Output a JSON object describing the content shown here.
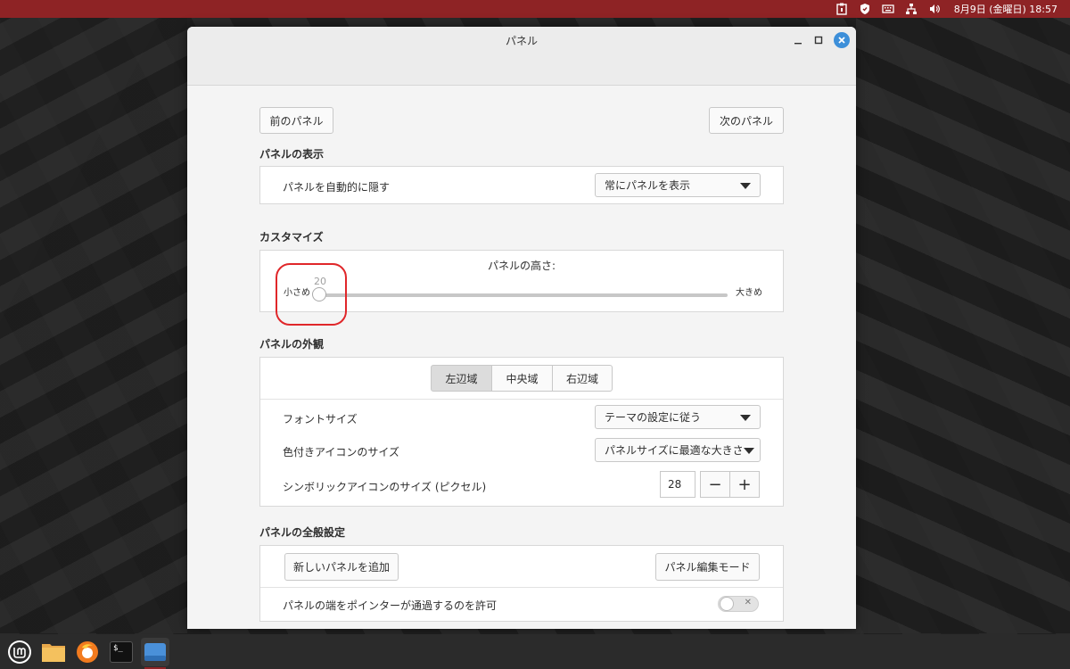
{
  "topbar": {
    "clock": "8月9日 (金曜日) 18:57",
    "color": "#8e2325",
    "icons": [
      "clipboard-icon",
      "shield-icon",
      "keyboard-icon",
      "network-icon",
      "volume-icon"
    ]
  },
  "window": {
    "title": "パネル",
    "controls": {
      "minimize": "_",
      "maximize": "□",
      "close": "×"
    }
  },
  "nav": {
    "prev_panel": "前のパネル",
    "next_panel": "次のパネル"
  },
  "display_section": {
    "title": "パネルの表示",
    "autohide_label": "パネルを自動的に隠す",
    "autohide_value": "常にパネルを表示"
  },
  "customize_section": {
    "title": "カスタマイズ",
    "height_label": "パネルの高さ:",
    "min_label": "小さめ",
    "max_label": "大きめ",
    "height_value": "20"
  },
  "appearance_section": {
    "title": "パネルの外観",
    "zones": [
      "左辺域",
      "中央域",
      "右辺域"
    ],
    "active_zone": "左辺域",
    "font_size_label": "フォントサイズ",
    "font_size_value": "テーマの設定に従う",
    "color_icon_label": "色付きアイコンのサイズ",
    "color_icon_value": "パネルサイズに最適な大きさ",
    "symbolic_icon_label": "シンボリックアイコンのサイズ (ピクセル)",
    "symbolic_icon_value": "28",
    "minus": "−",
    "plus": "+"
  },
  "general_section": {
    "title": "パネルの全般設定",
    "add_panel": "新しいパネルを追加",
    "edit_mode": "パネル編集モード",
    "pointer_pass_label": "パネルの端をポインターが通過するのを許可",
    "pointer_pass_enabled": false
  },
  "taskbar": {
    "icons": [
      "mint-menu-icon",
      "files-icon",
      "firefox-icon",
      "terminal-icon",
      "window-icon"
    ],
    "terminal_glyph": "$_"
  }
}
